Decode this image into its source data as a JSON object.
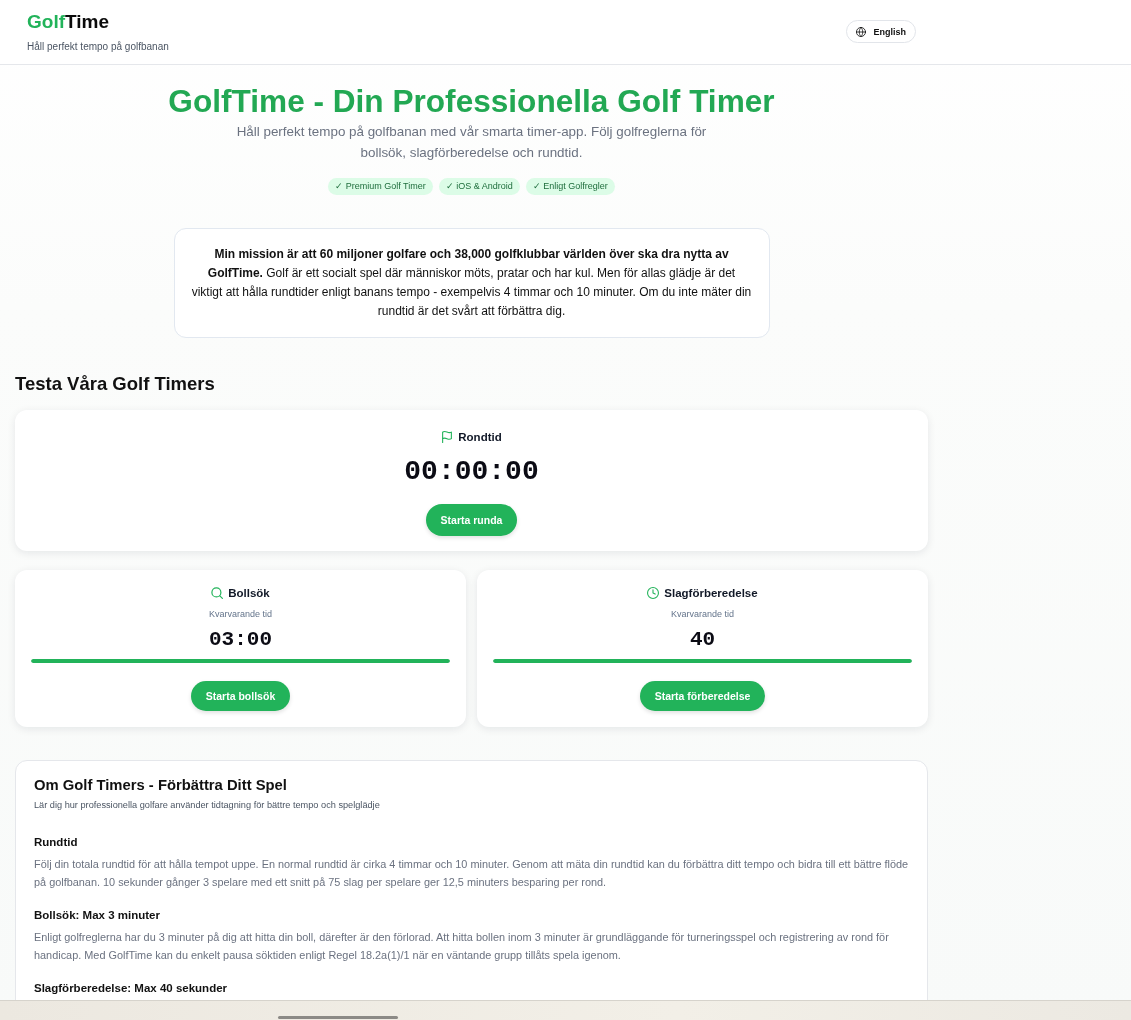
{
  "header": {
    "logo": {
      "accent_text": "Golf",
      "text": "Time"
    },
    "tagline": "Håll perfekt tempo på golfbanan",
    "language_button": "English"
  },
  "hero": {
    "title": "GolfTime - Din Professionella Golf Timer",
    "subtitle": "Håll perfekt tempo på golfbanan med vår smarta timer-app. Följ golfreglerna för bollsök, slagförberedelse och rundtid.",
    "badges": [
      "✓ Premium Golf Timer",
      "✓ iOS & Android",
      "✓ Enligt Golfregler"
    ]
  },
  "mission": "**Min mission är att 60 miljoner golfare och 38,000 golfklubbar världen över ska dra nytta av GolfTime.** Golf är ett socialt spel där människor möts, pratar och har kul. Men för allas glädje är det viktigt att hålla rundtider enligt banans tempo - exempelvis 4 timmar och 10 minuter. Om du inte mäter din rundtid är det svårt att förbättra dig.",
  "timers": {
    "heading": "Testa Våra Golf Timers",
    "items": [
      {
        "kind": "stopwatch",
        "label": "Rondtid",
        "time": "00:00:00",
        "button": "Starta runda"
      },
      {
        "kind": "countdown",
        "label": "Bollsök",
        "caption": "Kvarvarande tid",
        "time": "03:00",
        "level": 1,
        "button": "Starta bollsök"
      },
      {
        "kind": "countdown",
        "label": "Slagförberedelse",
        "caption": "Kvarvarande tid",
        "time": "40",
        "level": 1,
        "button": "Starta förberedelse"
      }
    ]
  },
  "about": {
    "title": "Om Golf Timers - Förbättra Ditt Spel",
    "subtitle": "Lär dig hur professionella golfare använder tidtagning för bättre tempo och spelglädje",
    "sections": [
      {
        "heading": "Rundtid",
        "text": "Följ din totala rundtid för att hålla tempot uppe. En normal rundtid är cirka 4 timmar och 10 minuter. Genom att mäta din rundtid kan du förbättra ditt tempo och bidra till ett bättre flöde på golfbanan. 10 sekunder gånger 3 spelare med ett snitt på 75 slag per spelare ger 12,5 minuters besparing per rond."
      },
      {
        "heading": "Bollsök: Max 3 minuter",
        "text": "Enligt golfreglerna har du 3 minuter på dig att hitta din boll, därefter är den förlorad. Att hitta bollen inom 3 minuter är grundläggande för turneringsspel och registrering av rond för handicap. Med GolfTime kan du enkelt pausa söktiden enligt Regel 18.2a(1)/1 när en väntande grupp tillåts spela igenom."
      },
      {
        "heading": "Slagförberedelse: Max 40 sekunder"
      }
    ]
  }
}
